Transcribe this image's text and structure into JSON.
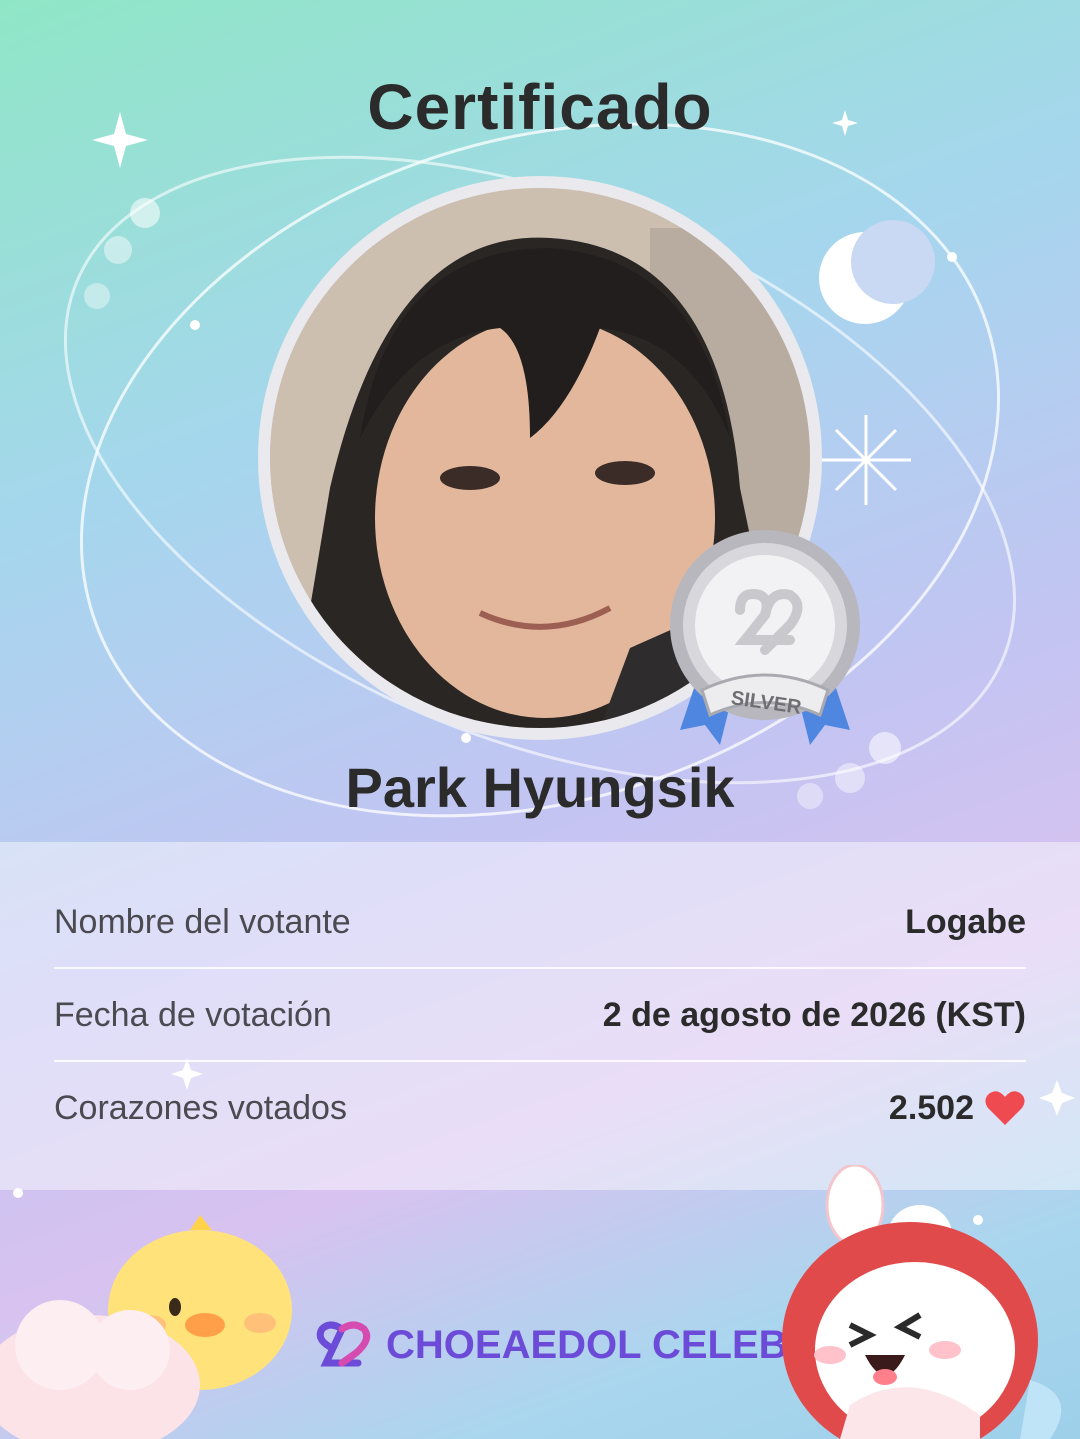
{
  "certificate": {
    "title": "Certificado",
    "celebrity_name": "Park Hyungsik",
    "badge_label": "SILVER"
  },
  "details": [
    {
      "label": "Nombre del votante",
      "value": "Logabe"
    },
    {
      "label": "Fecha de votación",
      "value": "2 de agosto de 2026 (KST)"
    },
    {
      "label": "Corazones votados",
      "value": "2.502"
    }
  ],
  "brand": {
    "name": "CHOEAEDOL CELEB"
  },
  "colors": {
    "brand_purple": "#6b4bd8",
    "heart_red": "#ef4a4f",
    "badge_silver": "#c9c9cf",
    "ribbon_blue": "#4f87e0"
  },
  "icons": [
    "sparkle-icon",
    "moon-icon",
    "silver-medal-icon",
    "heart-icon",
    "choeaedol-logo-icon",
    "chick-mascot",
    "bunny-mascot"
  ]
}
